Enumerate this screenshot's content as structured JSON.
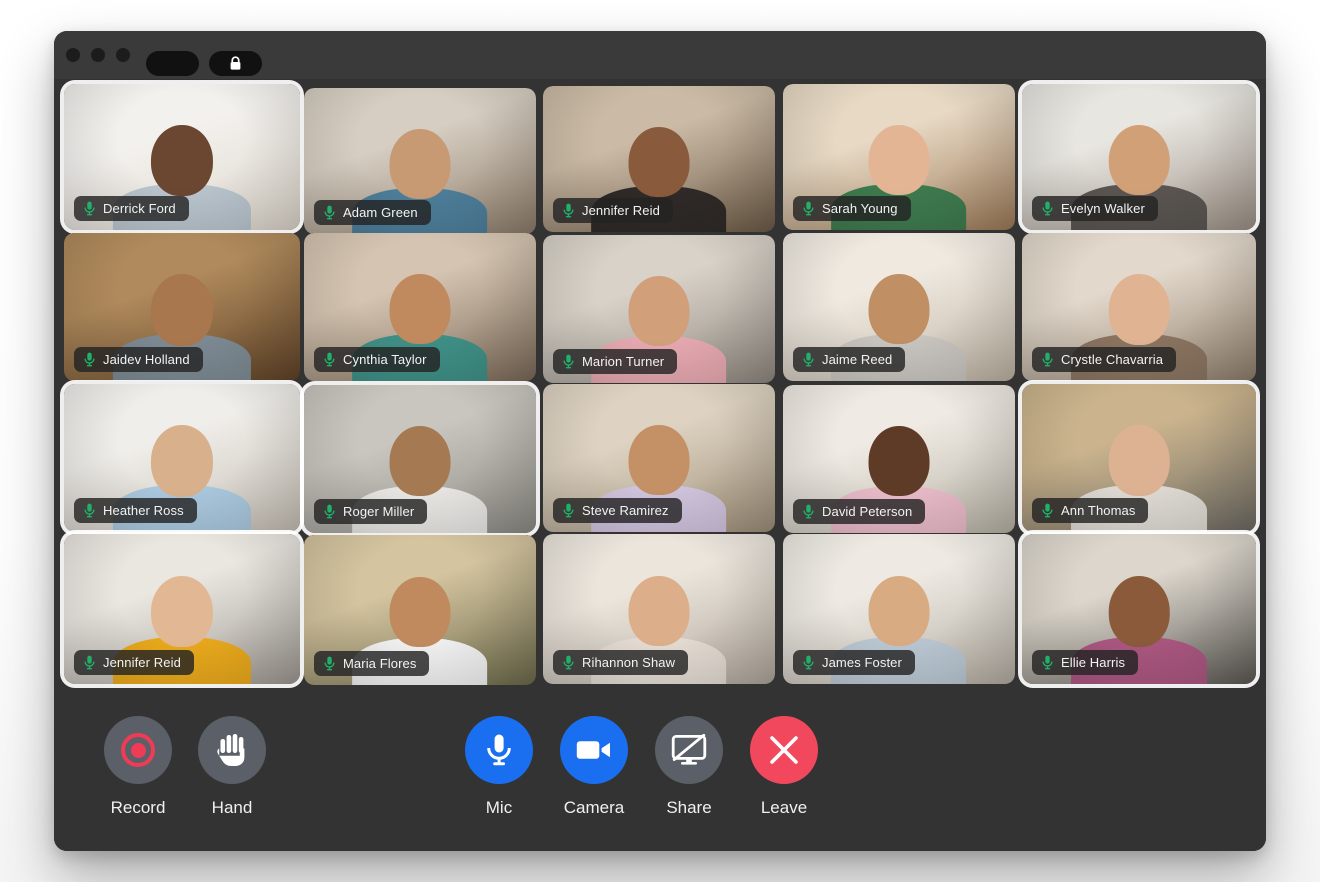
{
  "window": {
    "titlebar": {
      "traffic_lights": [
        "close",
        "minimize",
        "maximize"
      ],
      "tab_pill_label": "",
      "lock_icon": "lock-icon"
    },
    "background_color": "#333333"
  },
  "colors": {
    "window_bg": "#333333",
    "titlebar_bg": "#3a3a3a",
    "mic_green": "#21b06a",
    "accent_blue": "#1a6ff0",
    "leave_red": "#f2485d",
    "record_red": "#ef3b56",
    "neutral_gray": "#5b6068",
    "badge_bg": "rgba(35,35,35,0.82)",
    "label_text": "#f0f0f0"
  },
  "grid": {
    "columns": 5,
    "rows": 4,
    "participant_count": 20,
    "mic_icon": "microphone-icon",
    "participants": [
      {
        "name": "Derrick Ford",
        "framed": true,
        "muted": false,
        "skin": "#6b4630",
        "shirt": "#b9c4cd",
        "bg_a": "#f3f1ee",
        "bg_b": "#ddd6cb"
      },
      {
        "name": "Adam Green",
        "framed": false,
        "muted": false,
        "skin": "#c89a74",
        "shirt": "#4d7d99",
        "bg_a": "#d6cec2",
        "bg_b": "#8d7c69"
      },
      {
        "name": "Jennifer Reid",
        "framed": false,
        "muted": false,
        "skin": "#8a5a3c",
        "shirt": "#2f2a27",
        "bg_a": "#cbbba6",
        "bg_b": "#6d5a46"
      },
      {
        "name": "Sarah Young",
        "framed": false,
        "muted": false,
        "skin": "#e3b595",
        "shirt": "#3e7a4e",
        "bg_a": "#e7d9c4",
        "bg_b": "#9d7a58"
      },
      {
        "name": "Evelyn Walker",
        "framed": true,
        "muted": false,
        "skin": "#d2a077",
        "shirt": "#5a5550",
        "bg_a": "#e8e6e1",
        "bg_b": "#9c9085"
      },
      {
        "name": "Jaidev Holland",
        "framed": false,
        "muted": false,
        "skin": "#a9774d",
        "shirt": "#7d8a93",
        "bg_a": "#b08a5c",
        "bg_b": "#5f4327"
      },
      {
        "name": "Cynthia Taylor",
        "framed": false,
        "muted": false,
        "skin": "#c08a5e",
        "shirt": "#3f8f86",
        "bg_a": "#d5c4b1",
        "bg_b": "#7b6a58"
      },
      {
        "name": "Marion Turner",
        "framed": false,
        "muted": false,
        "skin": "#d1a07a",
        "shirt": "#e6a8b0",
        "bg_a": "#d8d2c8",
        "bg_b": "#8f8880"
      },
      {
        "name": "Jaime Reed",
        "framed": false,
        "muted": false,
        "skin": "#c08f63",
        "shirt": "#c8c5c0",
        "bg_a": "#efe9e0",
        "bg_b": "#bfb4a4"
      },
      {
        "name": "Crystle Chavarria",
        "framed": false,
        "muted": false,
        "skin": "#e0b393",
        "shirt": "#8a7460",
        "bg_a": "#e2d8cb",
        "bg_b": "#8f7f6c"
      },
      {
        "name": "Heather Ross",
        "framed": true,
        "muted": false,
        "skin": "#d9b08c",
        "shirt": "#a9c7dd",
        "bg_a": "#f0eeea",
        "bg_b": "#c6bfb4"
      },
      {
        "name": "Roger Miller",
        "framed": true,
        "muted": false,
        "skin": "#a57a52",
        "shirt": "#e6e5e2",
        "bg_a": "#c9c6bf",
        "bg_b": "#8d8b84"
      },
      {
        "name": "Steve Ramirez",
        "framed": false,
        "muted": false,
        "skin": "#c49066",
        "shirt": "#cfc2dc",
        "bg_a": "#ded3c2",
        "bg_b": "#9e8f79"
      },
      {
        "name": "David Peterson",
        "framed": false,
        "muted": false,
        "skin": "#5e3b26",
        "shirt": "#e7b9c6",
        "bg_a": "#efeae3",
        "bg_b": "#b8b2a6"
      },
      {
        "name": "Ann Thomas",
        "framed": true,
        "muted": false,
        "skin": "#ddb293",
        "shirt": "#ddd9d2",
        "bg_a": "#cbb48d",
        "bg_b": "#6d6a63"
      },
      {
        "name": "Jennifer Reid",
        "framed": true,
        "muted": false,
        "skin": "#e2b894",
        "shirt": "#e8a81c",
        "bg_a": "#eae7e1",
        "bg_b": "#9f9a92"
      },
      {
        "name": "Maria Flores",
        "framed": false,
        "muted": false,
        "skin": "#c08a5e",
        "shirt": "#efefef",
        "bg_a": "#d4c49f",
        "bg_b": "#6c6a4a"
      },
      {
        "name": "Rihannon Shaw",
        "framed": false,
        "muted": false,
        "skin": "#dcae8a",
        "shirt": "#e3dbd2",
        "bg_a": "#ebe5dc",
        "bg_b": "#b0a79c"
      },
      {
        "name": "James Foster",
        "framed": false,
        "muted": false,
        "skin": "#d9ab83",
        "shirt": "#b9c6d1",
        "bg_a": "#eeeae3",
        "bg_b": "#b4ada2"
      },
      {
        "name": "Ellie Harris",
        "framed": true,
        "muted": false,
        "skin": "#8a5a3a",
        "shirt": "#a9567f",
        "bg_a": "#dcd6cc",
        "bg_b": "#5c5954"
      }
    ]
  },
  "controls": {
    "left_group": [
      {
        "label": "Record",
        "icon": "record-icon",
        "style": "neutral",
        "active": false
      },
      {
        "label": "Hand",
        "icon": "raise-hand-icon",
        "style": "neutral",
        "active": false
      }
    ],
    "center_group": [
      {
        "label": "Mic",
        "icon": "microphone-icon",
        "style": "blue",
        "active": true
      },
      {
        "label": "Camera",
        "icon": "camera-icon",
        "style": "blue",
        "active": true
      },
      {
        "label": "Share",
        "icon": "share-screen-off-icon",
        "style": "neutral",
        "active": false
      },
      {
        "label": "Leave",
        "icon": "close-x-icon",
        "style": "red",
        "active": false
      }
    ]
  }
}
